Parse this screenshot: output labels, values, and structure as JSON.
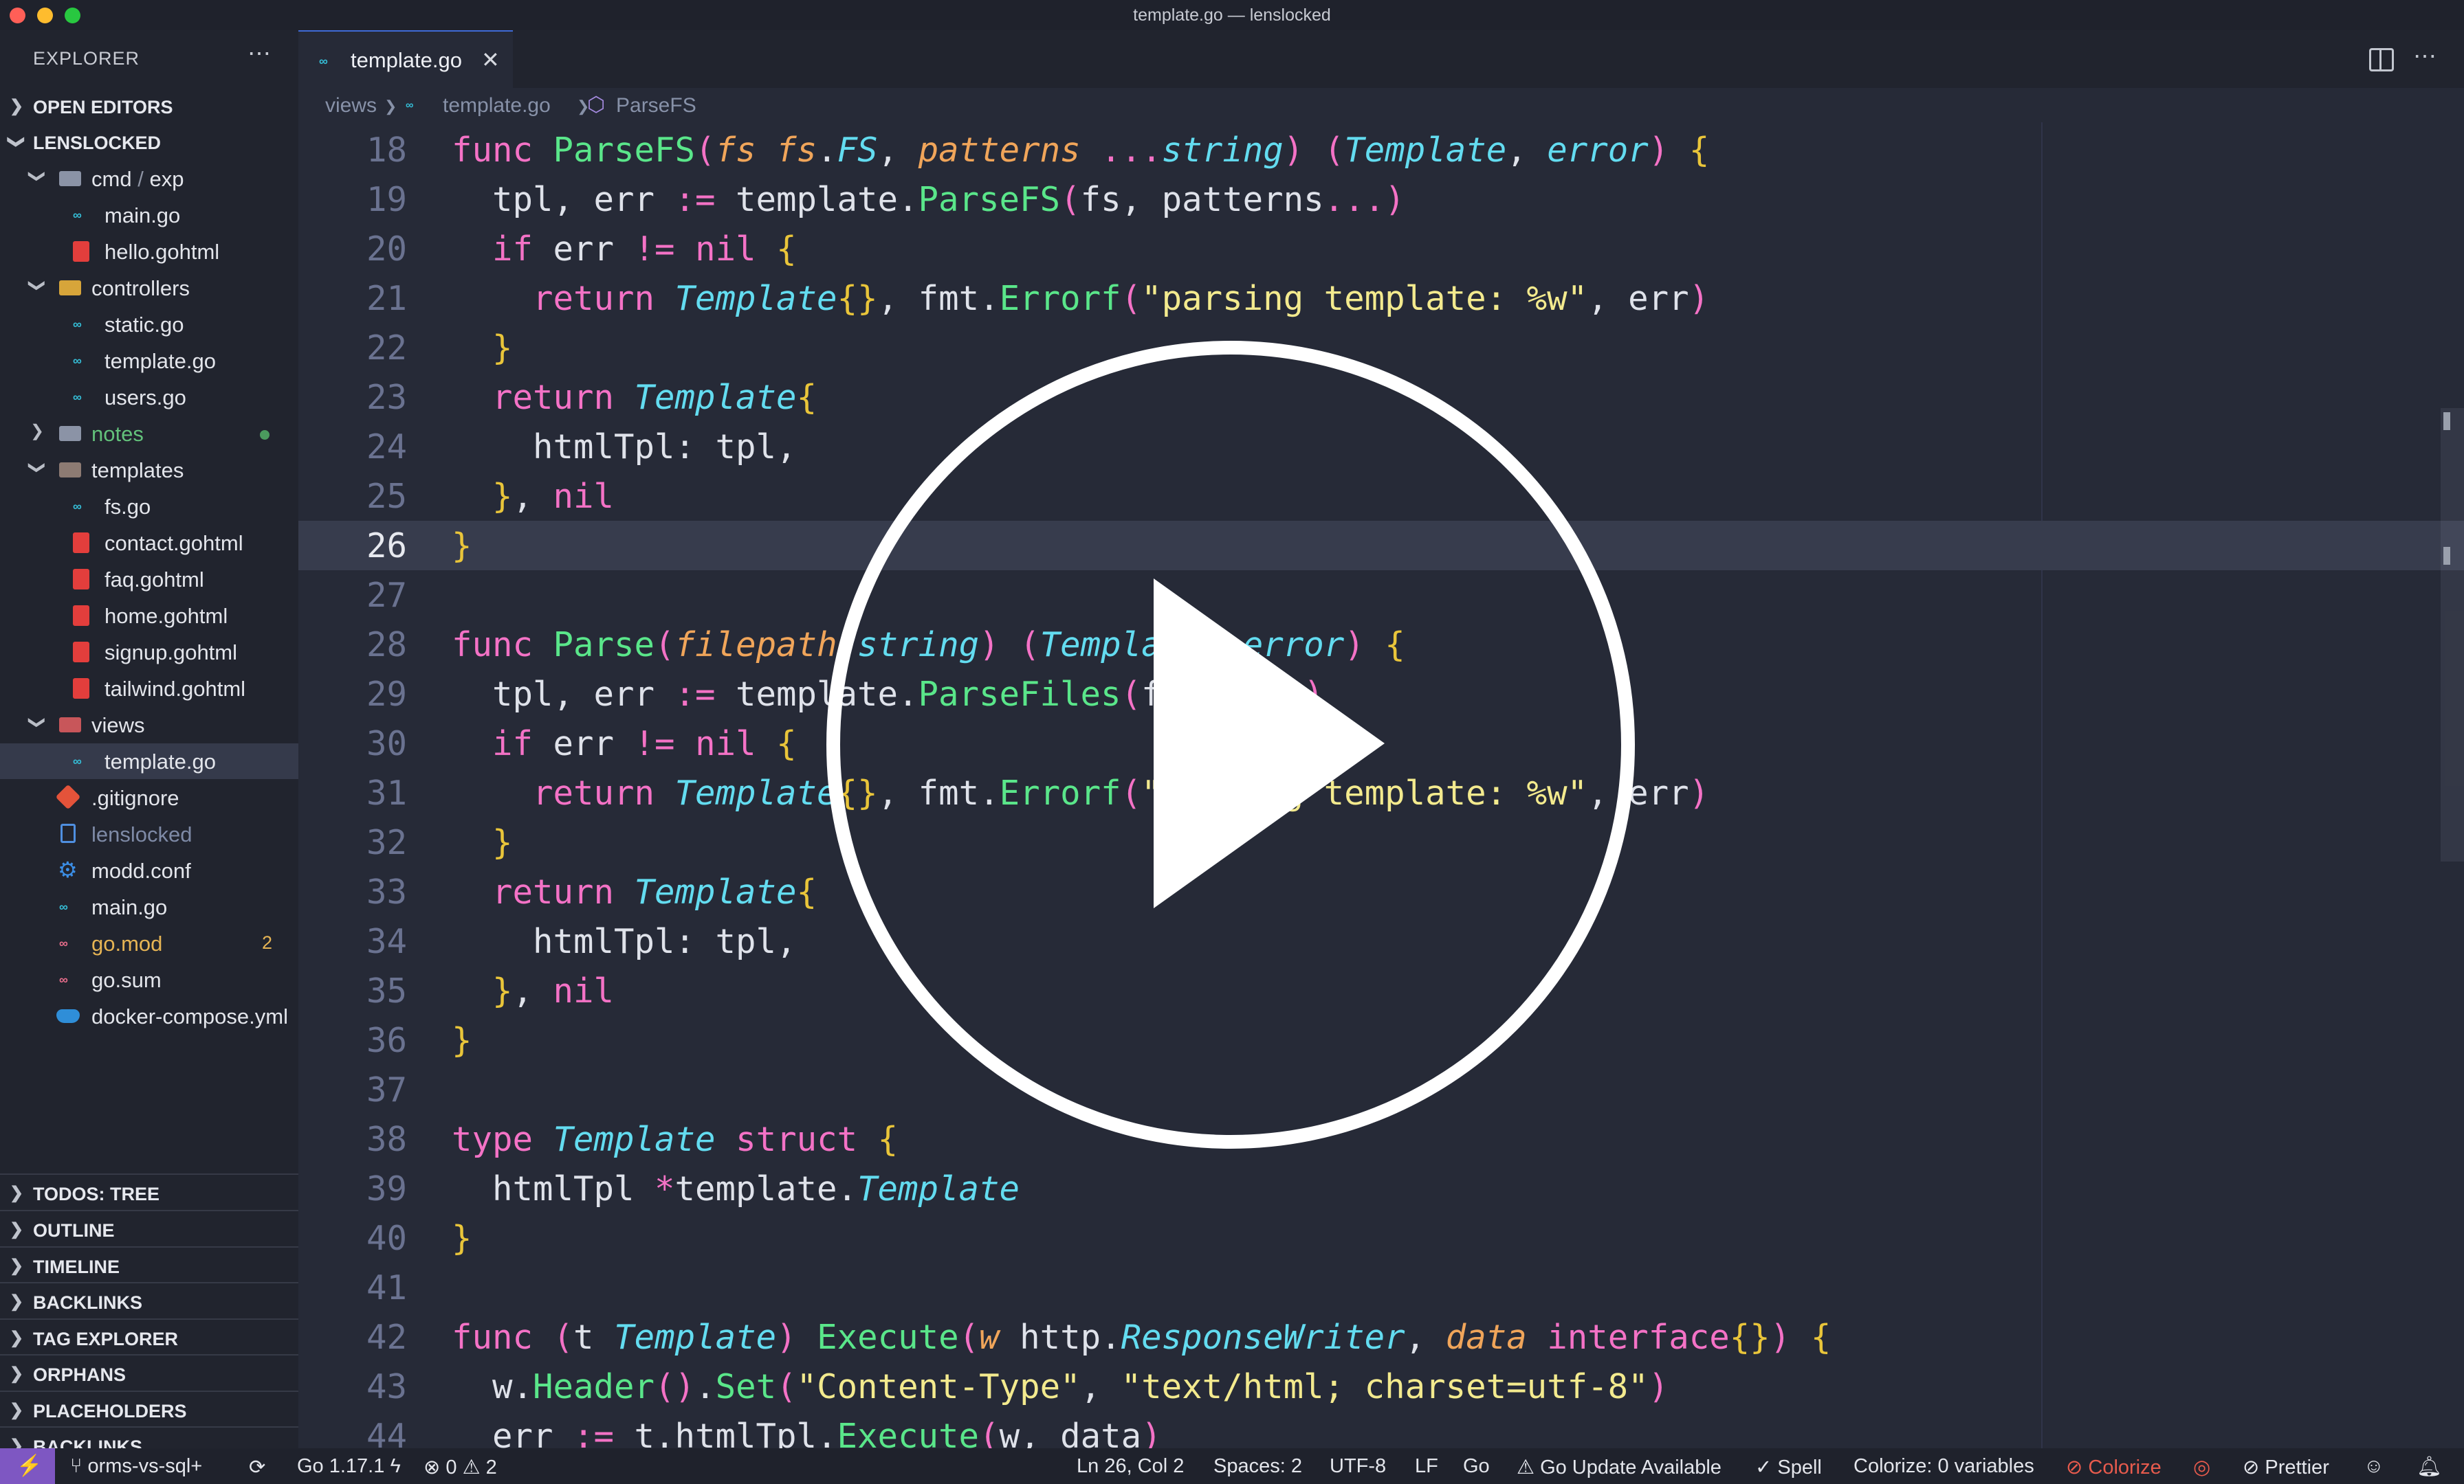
{
  "window": {
    "title": "template.go — lenslocked"
  },
  "sidebar": {
    "header": "EXPLORER",
    "menu_icon": "ellipsis-icon",
    "open_editors": "OPEN EDITORS",
    "project": "LENSLOCKED",
    "tree": [
      {
        "name": "cmd",
        "sep": "/",
        "name2": "exp",
        "type": "folder"
      },
      {
        "name": "main.go",
        "type": "go"
      },
      {
        "name": "hello.gohtml",
        "type": "html"
      },
      {
        "name": "controllers",
        "type": "folder"
      },
      {
        "name": "static.go",
        "type": "go"
      },
      {
        "name": "template.go",
        "type": "go"
      },
      {
        "name": "users.go",
        "type": "go"
      },
      {
        "name": "notes",
        "type": "folder",
        "status": "untracked"
      },
      {
        "name": "templates",
        "type": "folder"
      },
      {
        "name": "fs.go",
        "type": "go"
      },
      {
        "name": "contact.gohtml",
        "type": "html"
      },
      {
        "name": "faq.gohtml",
        "type": "html"
      },
      {
        "name": "home.gohtml",
        "type": "html"
      },
      {
        "name": "signup.gohtml",
        "type": "html"
      },
      {
        "name": "tailwind.gohtml",
        "type": "html"
      },
      {
        "name": "views",
        "type": "folder"
      },
      {
        "name": "template.go",
        "type": "go",
        "selected": true
      },
      {
        "name": ".gitignore",
        "type": "git"
      },
      {
        "name": "lenslocked",
        "type": "file"
      },
      {
        "name": "modd.conf",
        "type": "config"
      },
      {
        "name": "main.go",
        "type": "go"
      },
      {
        "name": "go.mod",
        "type": "go-mod",
        "badge": "2"
      },
      {
        "name": "go.sum",
        "type": "go"
      },
      {
        "name": "docker-compose.yml",
        "type": "docker"
      }
    ],
    "bottom_sections": [
      "TODOS: TREE",
      "OUTLINE",
      "TIMELINE",
      "BACKLINKS",
      "TAG EXPLORER",
      "ORPHANS",
      "PLACEHOLDERS",
      "BACKLINKS"
    ]
  },
  "editor": {
    "tab": {
      "label": "template.go",
      "icon": "go-file-icon"
    },
    "breadcrumb": [
      "views",
      "template.go",
      "ParseFS"
    ],
    "lines": [
      {
        "n": "18",
        "code": "func ParseFS(fs fs.FS, patterns ...string) (Template, error) {"
      },
      {
        "n": "19",
        "code": "  tpl, err := template.ParseFS(fs, patterns...)"
      },
      {
        "n": "20",
        "code": "  if err != nil {"
      },
      {
        "n": "21",
        "code": "    return Template{}, fmt.Errorf(\"parsing template: %w\", err)"
      },
      {
        "n": "22",
        "code": "  }"
      },
      {
        "n": "23",
        "code": "  return Template{"
      },
      {
        "n": "24",
        "code": "    htmlTpl: tpl,"
      },
      {
        "n": "25",
        "code": "  }, nil"
      },
      {
        "n": "26",
        "code": "}",
        "current": true
      },
      {
        "n": "27",
        "code": ""
      },
      {
        "n": "28",
        "code": "func Parse(filepath string) (Template, error) {"
      },
      {
        "n": "29",
        "code": "  tpl, err := template.ParseFiles(filepath)"
      },
      {
        "n": "30",
        "code": "  if err != nil {"
      },
      {
        "n": "31",
        "code": "    return Template{}, fmt.Errorf(\"parsing template: %w\", err)"
      },
      {
        "n": "32",
        "code": "  }"
      },
      {
        "n": "33",
        "code": "  return Template{"
      },
      {
        "n": "34",
        "code": "    htmlTpl: tpl,"
      },
      {
        "n": "35",
        "code": "  }, nil"
      },
      {
        "n": "36",
        "code": "}"
      },
      {
        "n": "37",
        "code": ""
      },
      {
        "n": "38",
        "code": "type Template struct {"
      },
      {
        "n": "39",
        "code": "  htmlTpl *template.Template"
      },
      {
        "n": "40",
        "code": "}"
      },
      {
        "n": "41",
        "code": ""
      },
      {
        "n": "42",
        "code": "func (t Template) Execute(w http.ResponseWriter, data interface{}) {"
      },
      {
        "n": "43",
        "code": "  w.Header().Set(\"Content-Type\", \"text/html; charset=utf-8\")"
      },
      {
        "n": "44",
        "code": "  err := t.htmlTpl.Execute(w, data)"
      }
    ]
  },
  "statusbar": {
    "branch": "orms-vs-sql+",
    "go_version": "Go 1.17.1",
    "errors": "0",
    "warnings": "2",
    "cursor": "Ln 26, Col 2",
    "spaces": "Spaces: 2",
    "encoding": "UTF-8",
    "eol": "LF",
    "language": "Go",
    "update": "Go Update Available",
    "spell": "Spell",
    "colorize_vars": "Colorize: 0 variables",
    "colorize": "Colorize",
    "prettier": "Prettier"
  },
  "overlay": {
    "icon": "play-button-icon"
  },
  "colors": {
    "keyword": "#f472c6",
    "function": "#5ae68a",
    "type": "#63dcf0",
    "param": "#f0a55a",
    "string": "#f3ea8e",
    "brace": "#e9c53a",
    "accent": "#7e57c2"
  }
}
